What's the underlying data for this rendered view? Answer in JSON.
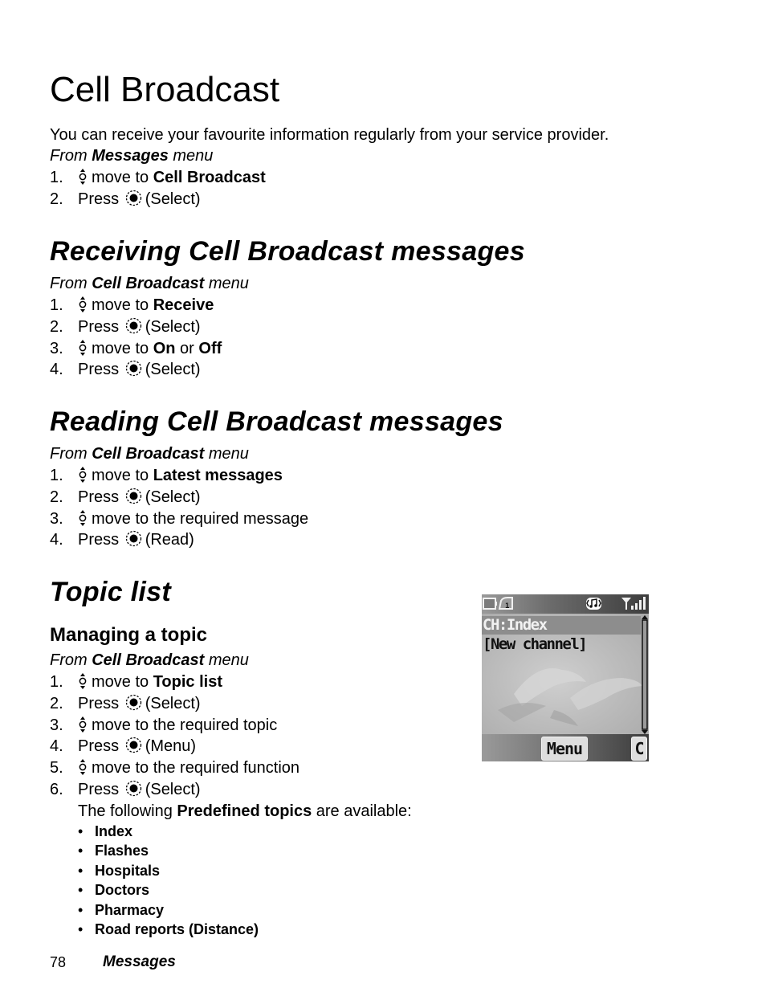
{
  "page": {
    "title": "Cell Broadcast",
    "intro": "You can receive your favourite information regularly from your service provider.",
    "intro_from": {
      "prefix": "From ",
      "menu": "Messages",
      "suffix": " menu"
    },
    "intro_steps": [
      {
        "num": "1.",
        "icon": "navigation-key-icon",
        "text": "move to ",
        "bold": "Cell Broadcast",
        "after": ""
      },
      {
        "num": "2.",
        "icon": "select-key-icon",
        "pre": "Press ",
        "text": "(Select)"
      }
    ]
  },
  "sections": {
    "receiving": {
      "heading": "Receiving Cell Broadcast messages",
      "from": {
        "prefix": "From ",
        "menu": "Cell Broadcast",
        "suffix": " menu"
      },
      "steps": [
        {
          "num": "1.",
          "icon": "navigation-key-icon",
          "text": "move to ",
          "bold": "Receive"
        },
        {
          "num": "2.",
          "icon": "select-key-icon",
          "pre": "Press ",
          "text": "(Select)"
        },
        {
          "num": "3.",
          "icon": "navigation-key-icon",
          "text": "move to ",
          "bold": "On",
          "mid": " or ",
          "bold2": "Off"
        },
        {
          "num": "4.",
          "icon": "select-key-icon",
          "pre": "Press ",
          "text": "(Select)"
        }
      ]
    },
    "reading": {
      "heading": "Reading Cell Broadcast messages",
      "from": {
        "prefix": "From ",
        "menu": "Cell Broadcast",
        "suffix": " menu"
      },
      "steps": [
        {
          "num": "1.",
          "icon": "navigation-key-icon",
          "text": "move to ",
          "bold": "Latest messages"
        },
        {
          "num": "2.",
          "icon": "select-key-icon",
          "pre": "Press ",
          "text": "(Select)"
        },
        {
          "num": "3.",
          "icon": "navigation-key-icon",
          "text": "move to the required message"
        },
        {
          "num": "4.",
          "icon": "select-key-icon",
          "pre": "Press ",
          "text": "(Read)"
        }
      ]
    },
    "topic_list": {
      "heading": "Topic list",
      "subheading": "Managing a topic",
      "from": {
        "prefix": "From ",
        "menu": "Cell Broadcast",
        "suffix": " menu"
      },
      "steps": [
        {
          "num": "1.",
          "icon": "navigation-key-icon",
          "text": "move to ",
          "bold": "Topic list"
        },
        {
          "num": "2.",
          "icon": "select-key-icon",
          "pre": "Press ",
          "text": "(Select)"
        },
        {
          "num": "3.",
          "icon": "navigation-key-icon",
          "text": "move to the required topic"
        },
        {
          "num": "4.",
          "icon": "select-key-icon",
          "pre": "Press ",
          "text": "(Menu)"
        },
        {
          "num": "5.",
          "icon": "navigation-key-icon",
          "text": "move to the required function"
        },
        {
          "num": "6.",
          "icon": "select-key-icon",
          "pre": "Press ",
          "text": "(Select)"
        }
      ],
      "note": {
        "prefix": "The following ",
        "bold": "Predefined topics",
        "suffix": " are available:"
      },
      "bullet_char": "•",
      "topics": [
        "Index",
        "Flashes",
        "Hospitals",
        "Doctors",
        "Pharmacy",
        "Road reports (Distance)"
      ]
    }
  },
  "phone_screen": {
    "status_icons": [
      "battery-icon",
      "line-1-icon",
      "ringtone-vibrate-icon",
      "signal-strength-icon"
    ],
    "line_label": "1",
    "items": [
      {
        "label": "CH:Index",
        "selected": true
      },
      {
        "label": "[New channel]",
        "selected": false
      }
    ],
    "softkeys": {
      "center": "Menu",
      "right": "C"
    },
    "colors": {
      "highlight": "#8d8d8d",
      "selected_text": "#f2f2f2",
      "text": "#111111"
    }
  },
  "footer": {
    "page_number": "78",
    "section": "Messages"
  }
}
